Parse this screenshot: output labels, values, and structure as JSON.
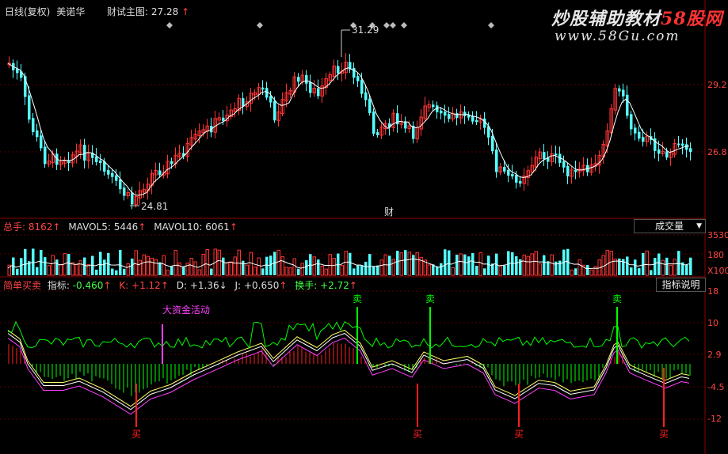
{
  "header": {
    "period": "日线(复权)",
    "stock_name": "美诺华",
    "formula_label": "财试主图:",
    "formula_value": "27.28",
    "up_arrow": "↑"
  },
  "watermark": {
    "line1_a": "炒股辅助教材",
    "line1_b": "58股网",
    "line2": "www.58Gu.com"
  },
  "price_panel": {
    "high_label": "31.29",
    "low_label": "24.81",
    "cai_marker": "财",
    "axis_ticks": [
      "29.2",
      "26.8"
    ]
  },
  "volume_panel": {
    "label_total": "总手:",
    "value_total": "8162",
    "label_ma5": "MAVOL5:",
    "value_ma5": "5446",
    "label_ma10": "MAVOL10:",
    "value_ma10": "6061",
    "dropdown_label": "成交量",
    "axis_ticks": [
      "3530",
      "180",
      "X100"
    ]
  },
  "indicator_panel": {
    "name": "简单买卖",
    "label_zb": "指标:",
    "value_zb": "-0.460",
    "label_k": "K:",
    "value_k": "+1.12",
    "label_d": "D:",
    "value_d": "+1.36",
    "label_j": "J:",
    "value_j": "+0.650",
    "label_hs": "换手:",
    "value_hs": "+2.72",
    "help_button": "指标说明",
    "big_fund": "大资金活动",
    "sell_label": "卖",
    "buy_label": "买",
    "axis_ticks": [
      "18",
      "10",
      "2.9",
      "-4.5",
      "-12"
    ]
  },
  "colors": {
    "up": "#ff3333",
    "down": "#54ffff",
    "grid": "#7a0000",
    "sell": "#00ff00",
    "buy": "#ff2020",
    "big": "#ff40ff"
  }
}
